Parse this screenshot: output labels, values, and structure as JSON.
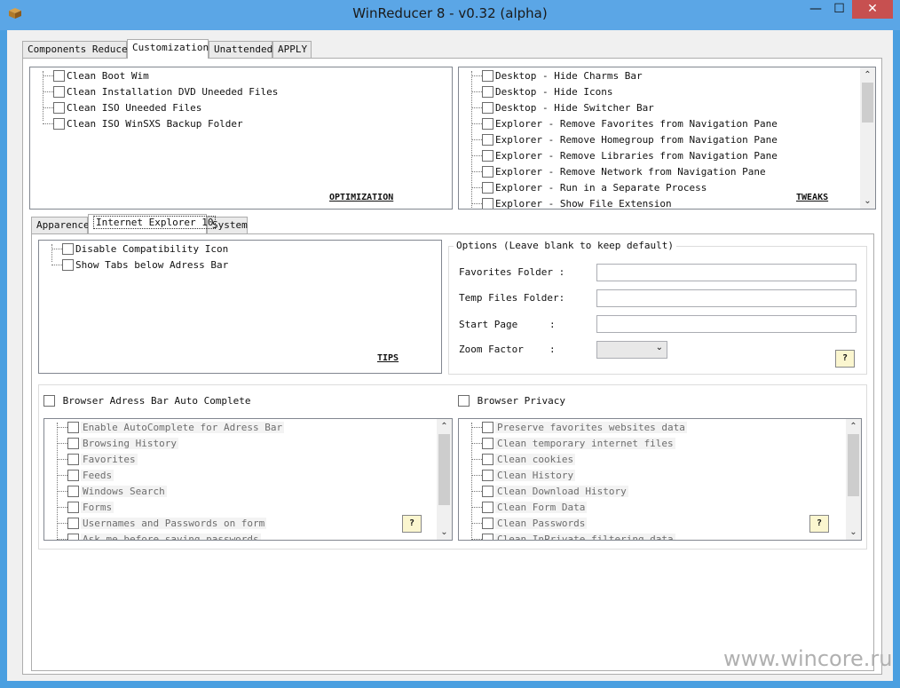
{
  "window": {
    "title": "WinReducer 8 - v0.32 (alpha)",
    "min_glyph": "—",
    "max_glyph": "☐",
    "close_glyph": "✕",
    "app_icon": "box-icon"
  },
  "main_tabs": [
    "Components Reducer",
    "Customization",
    "Unattended",
    "APPLY"
  ],
  "optimization": {
    "label": "OPTIMIZATION",
    "items": [
      "Clean Boot Wim",
      "Clean Installation DVD Uneeded Files",
      "Clean ISO Uneeded Files",
      "Clean ISO WinSXS Backup Folder"
    ]
  },
  "tweaks": {
    "label": "TWEAKS",
    "items": [
      "Desktop - Hide Charms Bar",
      "Desktop - Hide Icons",
      "Desktop - Hide Switcher Bar",
      "Explorer - Remove Favorites from Navigation Pane",
      "Explorer - Remove Homegroup from Navigation Pane",
      "Explorer - Remove Libraries from Navigation Pane",
      "Explorer - Remove Network from Navigation Pane",
      "Explorer - Run in a Separate Process",
      "Explorer - Show File Extension"
    ]
  },
  "sub_tabs": [
    "Apparence",
    "Internet Explorer 10",
    "System"
  ],
  "tips": {
    "label": "TIPS",
    "items": [
      "Disable Compatibility Icon",
      "Show Tabs below Adress Bar"
    ]
  },
  "options": {
    "legend": "Options (Leave blank to keep default)",
    "favorites_label": "Favorites Folder :",
    "temp_label": "Temp Files Folder:",
    "start_label": "Start Page",
    "start_colon": ":",
    "zoom_label": "Zoom Factor",
    "zoom_colon": ":",
    "help": "?"
  },
  "autocomplete": {
    "title": "Browser Adress Bar Auto Complete",
    "items": [
      "Enable AutoComplete for Adress Bar",
      "Browsing History",
      "Favorites",
      "Feeds",
      "Windows Search",
      "Forms",
      "Usernames and Passwords on form",
      "Ask me before saving passwords"
    ],
    "help": "?"
  },
  "privacy": {
    "title": "Browser Privacy",
    "items": [
      "Preserve favorites websites data",
      "Clean temporary internet files",
      "Clean cookies",
      "Clean History",
      "Clean Download History",
      "Clean Form Data",
      "Clean Passwords",
      "Clean InPrivate filtering data"
    ],
    "help": "?"
  },
  "watermark": "www.wincore.ru"
}
